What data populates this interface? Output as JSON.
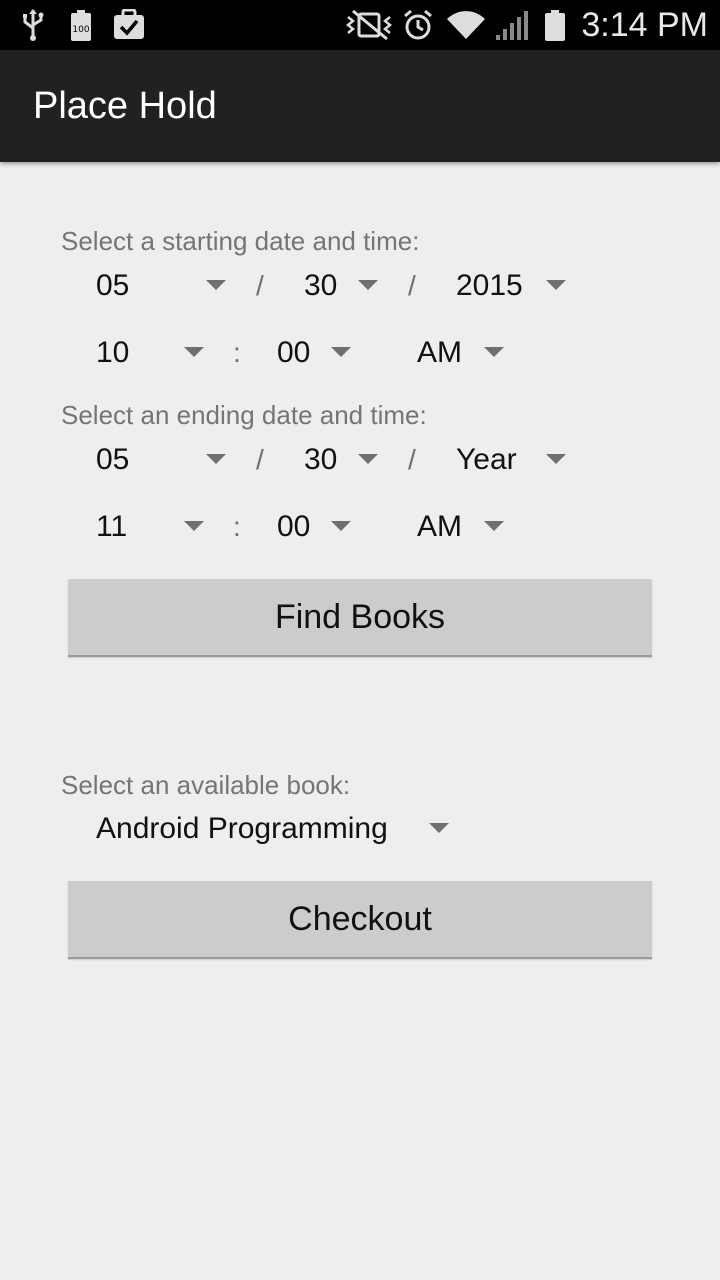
{
  "status_bar": {
    "time": "3:14 PM",
    "icons": [
      "usb-icon",
      "battery-100-icon",
      "clipboard-check-icon",
      "vibrate-mute-icon",
      "alarm-icon",
      "wifi-icon",
      "signal-icon",
      "battery-icon"
    ],
    "battery_badge": "100"
  },
  "action_bar": {
    "title": "Place Hold"
  },
  "start": {
    "label": "Select a starting date and time:",
    "month": "05",
    "day": "30",
    "year": "2015",
    "hour": "10",
    "minute": "00",
    "ampm": "AM"
  },
  "end": {
    "label": "Select an ending date and time:",
    "month": "05",
    "day": "30",
    "year": "Year",
    "hour": "11",
    "minute": "00",
    "ampm": "AM"
  },
  "separators": {
    "date": "/",
    "time": ":"
  },
  "find_books_label": "Find Books",
  "book": {
    "label": "Select an available book:",
    "selected": "Android Programming"
  },
  "checkout_label": "Checkout",
  "colors": {
    "status_bar_bg": "#000000",
    "action_bar_bg": "#212121",
    "page_bg": "#eeeeee",
    "button_bg": "#cccccc",
    "label_color": "#757575"
  }
}
